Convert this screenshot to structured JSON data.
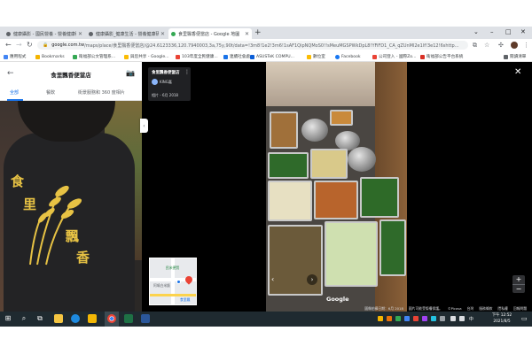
{
  "browser": {
    "tabs": [
      {
        "label": "健康攝影 - 國民營養 - 營養健康研究...",
        "active": false
      },
      {
        "label": "健康攝影_健康生活 - 營養健康研究...",
        "active": false
      },
      {
        "label": "食里飄香便當店 - Google 地圖",
        "active": true
      }
    ],
    "new_tab": "+",
    "window_controls": {
      "menu": "⌄",
      "minimize": "–",
      "maximize": "□",
      "close": "✕"
    },
    "url_host": "google.com.tw",
    "url_path": "/maps/place/食里飄香便當店/@24.6123336,120.7940003,3a,75y,90t/data=!3m8!1e2!3m6!1sAF1QipNQMoS0!!sMeuMGSPWkDpL8!YFiFD1_CA_qZUnMl2e1lf!3e12!6shttp...",
    "bookmarks": [
      {
        "label": "應用程式",
        "color": "#4285f4"
      },
      {
        "label": "Bookmarks",
        "color": "#f4b400"
      },
      {
        "label": "衛福部公文管理系...",
        "color": "#34a853"
      },
      {
        "label": "與您共享 - Google...",
        "color": "#fbbc04"
      },
      {
        "label": "103年度全民健康...",
        "color": "#ea4335"
      },
      {
        "label": "連續社會處",
        "color": "#1a73e8"
      },
      {
        "label": "ASUSTeK COMPU...",
        "color": "#0b5ed7"
      },
      {
        "label": "數位室",
        "color": "#fbbc04"
      },
      {
        "label": "Facebook",
        "color": "#1877f2"
      },
      {
        "label": "公司登入 - 國際Zo...",
        "color": "#ea4335"
      },
      {
        "label": "衛福部公告平台系統",
        "color": "#d93025"
      },
      {
        "label": "閱讀清單",
        "color": "#5f6368"
      }
    ]
  },
  "maps_panel": {
    "title": "食里飄香便當店",
    "tabs": [
      "全部",
      "餐飲",
      "街景服務和 360 度相片"
    ],
    "shirt_text": [
      "食",
      "里",
      "飄",
      "香"
    ]
  },
  "viewer": {
    "place_name": "食里飄香便當店",
    "author": "KING嘉",
    "date": "相片 - 6月 2018",
    "watermark": "Google",
    "map_labels": {
      "park": "民米德賢",
      "store": "阿鳩白米飯",
      "place": "食里飄"
    },
    "zoom_in": "+",
    "zoom_out": "−",
    "footer": [
      "圖像拍攝日期：6月 2018",
      "圖片可能受版權保護。",
      "©Picasa",
      "台灣",
      "服務條款",
      "隱私權",
      "回報問題"
    ]
  },
  "taskbar": {
    "lang": "中",
    "time": "下午 12:52",
    "date": "2021/8/5"
  },
  "colors": {
    "accent": "#1a73e8",
    "shirt_print": "#e7c244",
    "taskbar": "#1f2a30"
  }
}
